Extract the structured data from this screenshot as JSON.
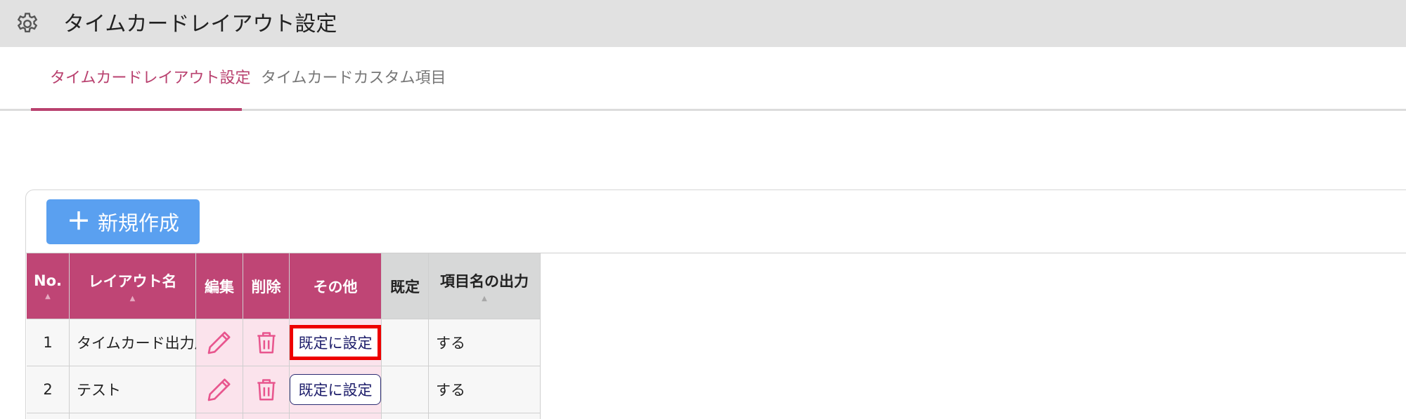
{
  "window": {
    "title": "タイムカードレイアウト設定",
    "icon": "gear-icon"
  },
  "tabs": [
    {
      "label": "タイムカードレイアウト設定",
      "active": true
    },
    {
      "label": "タイムカードカスタム項目",
      "active": false
    }
  ],
  "toolbar": {
    "new_button_label": "新規作成",
    "new_button_icon": "plus-icon"
  },
  "table": {
    "headers": {
      "no": "No.",
      "layout_name": "レイアウト名",
      "edit": "編集",
      "delete": "削除",
      "other": "その他",
      "default": "既定",
      "item_name_output": "項目名の出力"
    },
    "rows": [
      {
        "no": "1",
        "layout_name": "タイムカード出力用",
        "action_label": "既定に設定",
        "default": "",
        "item_name_output": "する"
      },
      {
        "no": "2",
        "layout_name": "テスト",
        "action_label": "既定に設定",
        "default": "",
        "item_name_output": "する"
      }
    ]
  },
  "colors": {
    "accent": "#bf4575",
    "tab_active": "#b9416f",
    "new_button": "#5aa0f0",
    "icon_pink": "#e8568e",
    "highlight": "#ee0000"
  }
}
